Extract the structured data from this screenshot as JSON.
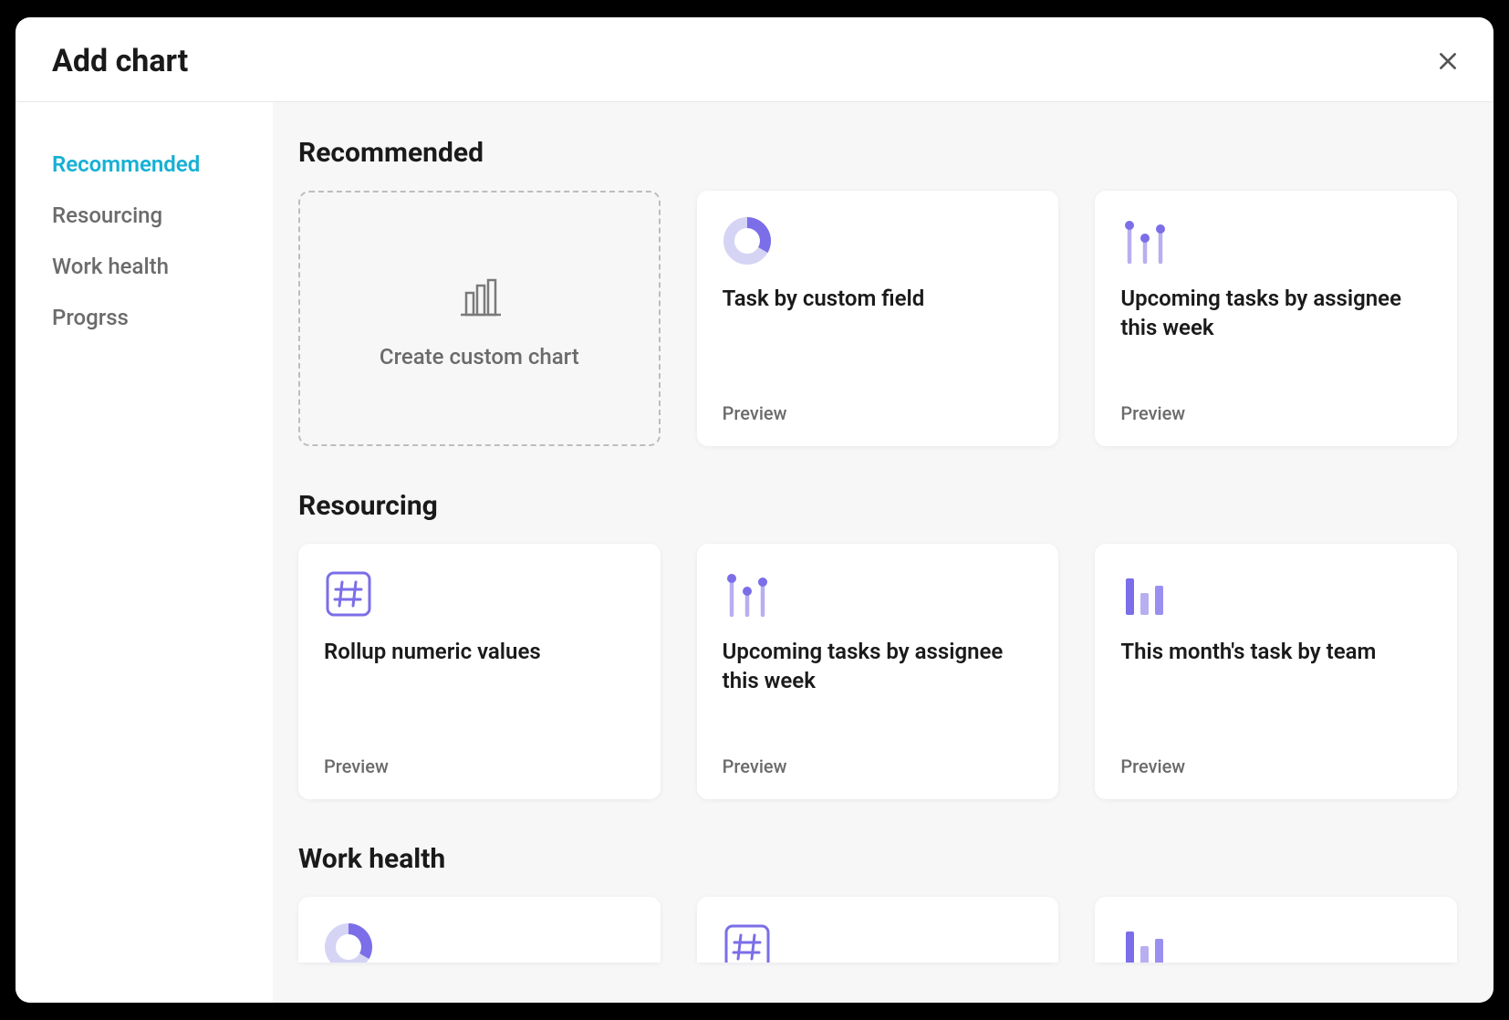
{
  "modal": {
    "title": "Add chart"
  },
  "sidebar": {
    "items": [
      {
        "label": "Recommended",
        "active": true
      },
      {
        "label": "Resourcing",
        "active": false
      },
      {
        "label": "Work health",
        "active": false
      },
      {
        "label": "Progrss",
        "active": false
      }
    ]
  },
  "sections": {
    "recommended": {
      "title": "Recommended",
      "create_label": "Create custom chart",
      "cards": [
        {
          "title": "Task by custom field",
          "preview": "Preview",
          "icon": "donut"
        },
        {
          "title": "Upcoming tasks by assignee this week",
          "preview": "Preview",
          "icon": "lollipop"
        }
      ]
    },
    "resourcing": {
      "title": "Resourcing",
      "cards": [
        {
          "title": "Rollup numeric values",
          "preview": "Preview",
          "icon": "hash"
        },
        {
          "title": "Upcoming tasks by assignee this week",
          "preview": "Preview",
          "icon": "lollipop"
        },
        {
          "title": "This month's task by team",
          "preview": "Preview",
          "icon": "bars"
        }
      ]
    },
    "work_health": {
      "title": "Work health",
      "partial_icons": [
        "donut",
        "hash",
        "bars"
      ]
    }
  }
}
